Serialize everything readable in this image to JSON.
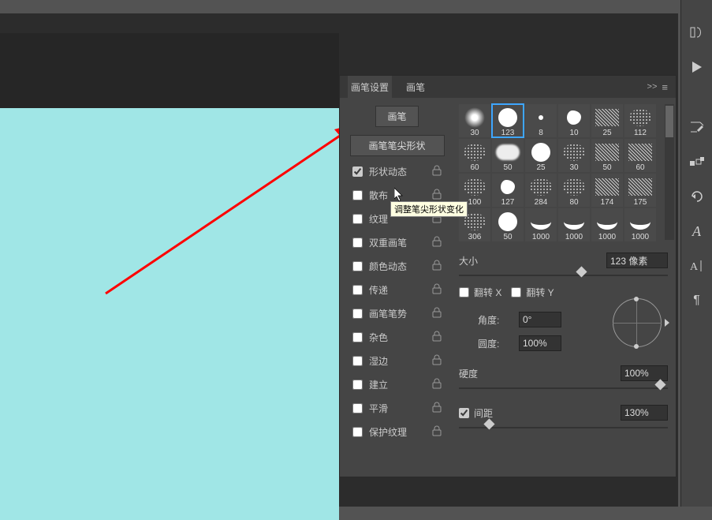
{
  "panel": {
    "tabs": {
      "settings": "画笔设置",
      "brushes": "画笔"
    },
    "expand": ">>"
  },
  "left": {
    "brush": "画笔",
    "tip_shape": "画笔笔尖形状",
    "options": [
      {
        "key": "shape_dynamics",
        "label": "形状动态",
        "checked": true
      },
      {
        "key": "scattering",
        "label": "散布",
        "checked": false
      },
      {
        "key": "texture",
        "label": "纹理",
        "checked": false
      },
      {
        "key": "dual_brush",
        "label": "双重画笔",
        "checked": false
      },
      {
        "key": "color_dynamics",
        "label": "颜色动态",
        "checked": false
      },
      {
        "key": "transfer",
        "label": "传递",
        "checked": false
      },
      {
        "key": "pose",
        "label": "画笔笔势",
        "checked": false
      },
      {
        "key": "noise",
        "label": "杂色",
        "checked": false
      },
      {
        "key": "wet_edges",
        "label": "湿边",
        "checked": false
      },
      {
        "key": "build_up",
        "label": "建立",
        "checked": false
      },
      {
        "key": "smoothing",
        "label": "平滑",
        "checked": false
      },
      {
        "key": "protect_texture",
        "label": "保护纹理",
        "checked": false
      }
    ]
  },
  "thumbs": [
    {
      "size": "30"
    },
    {
      "size": "123",
      "active": true
    },
    {
      "size": "8"
    },
    {
      "size": "10"
    },
    {
      "size": "25"
    },
    {
      "size": "112"
    },
    {
      "size": "60"
    },
    {
      "size": "50"
    },
    {
      "size": "25"
    },
    {
      "size": "30"
    },
    {
      "size": "50"
    },
    {
      "size": "60"
    },
    {
      "size": "100"
    },
    {
      "size": "127"
    },
    {
      "size": "284"
    },
    {
      "size": "80"
    },
    {
      "size": "174"
    },
    {
      "size": "175"
    },
    {
      "size": "306"
    },
    {
      "size": "50"
    },
    {
      "size": "1000"
    },
    {
      "size": "1000"
    },
    {
      "size": "1000"
    },
    {
      "size": "1000"
    }
  ],
  "params": {
    "size_label": "大小",
    "size_value": "123 像素",
    "flip_x": "翻转 X",
    "flip_y": "翻转 Y",
    "angle_label": "角度:",
    "angle_value": "0°",
    "roundness_label": "圆度:",
    "roundness_value": "100%",
    "hardness_label": "硬度",
    "hardness_value": "100%",
    "spacing_label": "间距",
    "spacing_value": "130%"
  },
  "tooltip": "调整笔尖形状变化",
  "toolbar_icons": [
    "history-icon",
    "play-icon",
    "brush-edit-icon",
    "swatches-icon",
    "undo-icon",
    "glyphs-icon",
    "align-icon",
    "paragraph-icon"
  ]
}
